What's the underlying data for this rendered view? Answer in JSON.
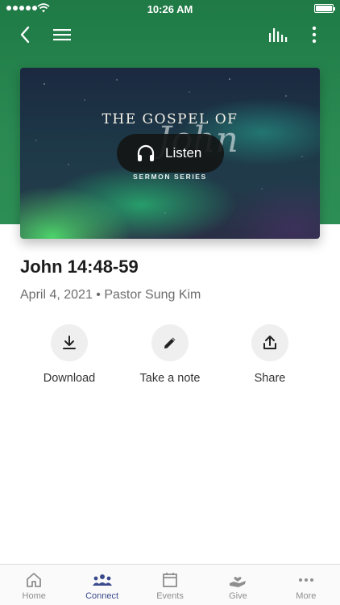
{
  "status_bar": {
    "time": "10:26 AM"
  },
  "colors": {
    "header": "#2a8a52",
    "active_tab": "#3b4a8c",
    "inactive_tab": "#8e8e8e"
  },
  "nav": {
    "back_icon": "chevron-left-icon",
    "menu_icon": "hamburger-icon",
    "audio_icon": "audio-bars-icon",
    "more_icon": "vertical-dots-icon"
  },
  "hero": {
    "title": "THE GOSPEL OF",
    "script_text": "John",
    "subtitle": "SERMON SERIES",
    "listen_label": "Listen",
    "listen_icon": "headphones-icon"
  },
  "sermon": {
    "title": "John 14:48-59",
    "meta": "April 4, 2021 • Pastor Sung Kim"
  },
  "actions": [
    {
      "label": "Download",
      "icon": "download-icon"
    },
    {
      "label": "Take a note",
      "icon": "pencil-icon"
    },
    {
      "label": "Share",
      "icon": "share-icon"
    }
  ],
  "tabs": [
    {
      "label": "Home",
      "icon": "home-icon",
      "active": false
    },
    {
      "label": "Connect",
      "icon": "people-icon",
      "active": true
    },
    {
      "label": "Events",
      "icon": "calendar-icon",
      "active": false
    },
    {
      "label": "Give",
      "icon": "giving-hand-icon",
      "active": false
    },
    {
      "label": "More",
      "icon": "more-dots-icon",
      "active": false
    }
  ]
}
